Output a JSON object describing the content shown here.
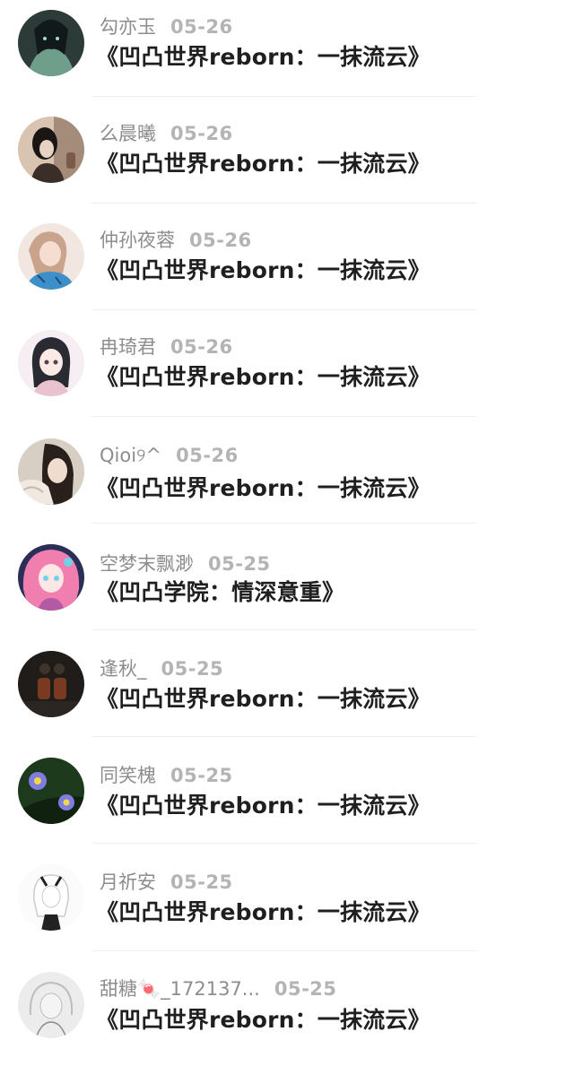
{
  "items": [
    {
      "name": "勾亦玉",
      "date": "05-26",
      "title": "《凹凸世界reborn：一抹流云》",
      "avatar_icon": "avatar-dark-anime-icon",
      "avatar_colors": [
        "#2c3a38",
        "#6f9f8a",
        "#11191a"
      ]
    },
    {
      "name": "么晨曦",
      "date": "05-26",
      "title": "《凹凸世界reborn：一抹流云》",
      "avatar_icon": "avatar-photo-girl-icon",
      "avatar_colors": [
        "#d9c4b2",
        "#1b1613",
        "#a58c7a"
      ]
    },
    {
      "name": "仲孙夜蓉",
      "date": "05-26",
      "title": "《凹凸世界reborn：一抹流云》",
      "avatar_icon": "avatar-selfie-girl-icon",
      "avatar_colors": [
        "#f2e6e0",
        "#3c8fc9",
        "#c9a38b"
      ]
    },
    {
      "name": "冉琦君",
      "date": "05-26",
      "title": "《凹凸世界reborn：一抹流云》",
      "avatar_icon": "avatar-anime-girl-icon",
      "avatar_colors": [
        "#f6eef2",
        "#2a2a33",
        "#e9c1cf"
      ]
    },
    {
      "name": "Qioi୨^",
      "date": "05-26",
      "title": "《凹凸世界reborn：一抹流云》",
      "avatar_icon": "avatar-photo-girl-icon",
      "avatar_colors": [
        "#d7cfc4",
        "#2a201b",
        "#efe9e2"
      ]
    },
    {
      "name": "空梦末飘渺",
      "date": "05-25",
      "title": "《凹凸学院：情深意重》",
      "avatar_icon": "avatar-pink-hair-anime-icon",
      "avatar_colors": [
        "#f07fb0",
        "#6fd1e8",
        "#2a2f58"
      ]
    },
    {
      "name": "逢秋_",
      "date": "05-25",
      "title": "《凹凸世界reborn：一抹流云》",
      "avatar_icon": "avatar-dark-figures-icon",
      "avatar_colors": [
        "#1f1c19",
        "#7a3a22",
        "#3d352c"
      ]
    },
    {
      "name": "同笑槐",
      "date": "05-25",
      "title": "《凹凸世界reborn：一抹流云》",
      "avatar_icon": "avatar-purple-flower-icon",
      "avatar_colors": [
        "#1e3a1c",
        "#7f7de0",
        "#f2d64a"
      ]
    },
    {
      "name": "月祈安",
      "date": "05-25",
      "title": "《凹凸世界reborn：一抹流云》",
      "avatar_icon": "avatar-sketch-anime-icon",
      "avatar_colors": [
        "#fbfbfb",
        "#222222",
        "#c9c9d6"
      ]
    },
    {
      "name": "甜糖🍬_172137...",
      "date": "05-25",
      "title": "《凹凸世界reborn：一抹流云》",
      "avatar_icon": "avatar-sketch-girl-icon",
      "avatar_colors": [
        "#ececec",
        "#bdbdbd",
        "#8a8a8a"
      ]
    }
  ]
}
